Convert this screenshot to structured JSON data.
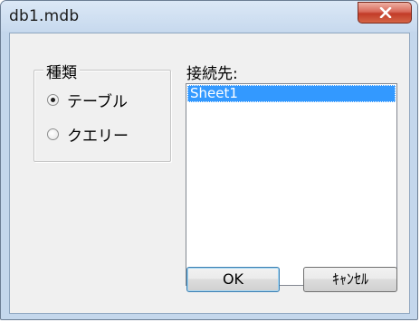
{
  "window": {
    "title": "db1.mdb"
  },
  "group": {
    "legend": "種類",
    "options": [
      {
        "label": "テーブル",
        "checked": true
      },
      {
        "label": "クエリー",
        "checked": false
      }
    ]
  },
  "connect": {
    "label": "接続先:",
    "items": [
      "Sheet1"
    ],
    "selected_index": 0
  },
  "buttons": {
    "ok": "OK",
    "cancel": "ｷｬﾝｾﾙ"
  },
  "icons": {
    "close": "close-icon"
  },
  "colors": {
    "selection": "#3399ff",
    "close_button": "#c23b28",
    "frame": "#c4d7ec"
  }
}
